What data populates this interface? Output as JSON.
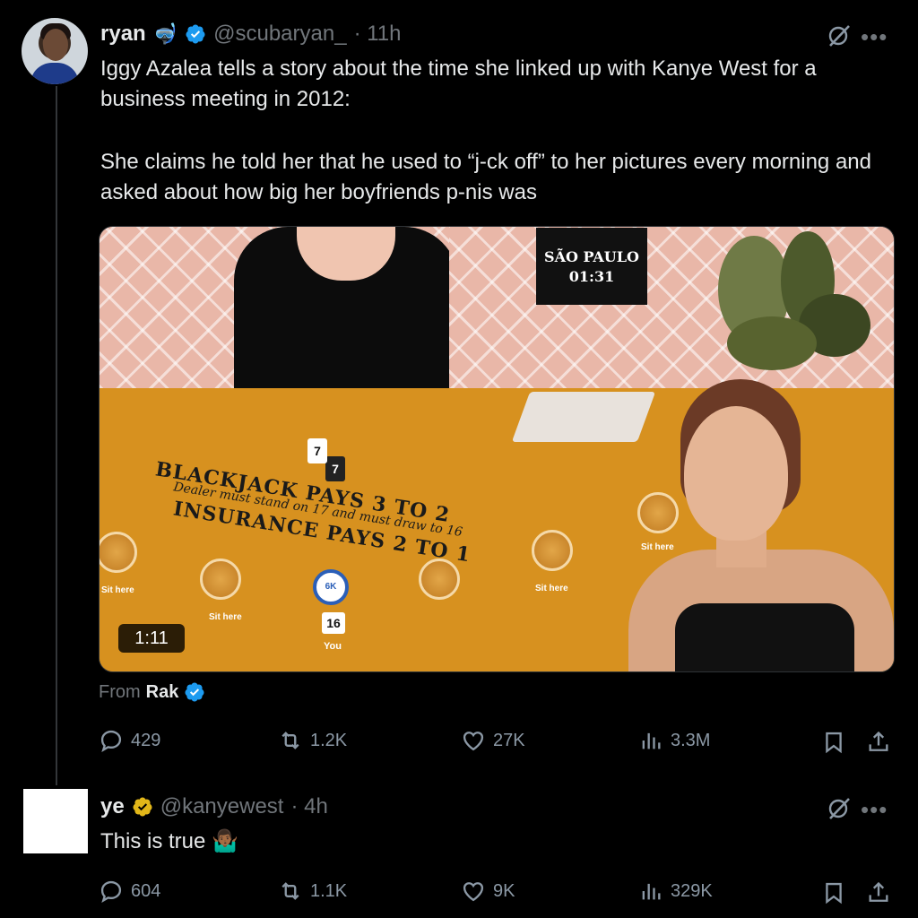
{
  "tweet1": {
    "name": "ryan",
    "name_emoji": "🤿",
    "handle": "@scubaryan_",
    "time": "· 11h",
    "text_p1": "Iggy Azalea tells a story about the time she linked up with Kanye West for a business meeting in 2012:",
    "text_p2": "She claims he told her that he used to “j-ck off” to her pictures every morning and asked about how big her boyfriends p-nis was",
    "video": {
      "duration": "1:11",
      "location": "SÃO PAULO",
      "location_time": "01:31",
      "table_text_main": "BLACKJACK PAYS 3 TO 2",
      "table_text_rule": "Dealer must stand on 17 and must draw to 16",
      "table_text_insurance": "INSURANCE PAYS 2 TO 1",
      "seat_label": "Sit here",
      "card_value": "7",
      "chip_label": "6K",
      "hand_total": "16",
      "you_label": "You"
    },
    "from_prefix": "From",
    "from_source": "Rak",
    "stats": {
      "replies": "429",
      "reposts": "1.2K",
      "likes": "27K",
      "views": "3.3M"
    }
  },
  "tweet2": {
    "name": "ye",
    "handle": "@kanyewest",
    "time": "· 4h",
    "text": "This is true 🤷🏾‍♂️",
    "stats": {
      "replies": "604",
      "reposts": "1.1K",
      "likes": "9K",
      "views": "329K"
    }
  },
  "colors": {
    "background": "#000000",
    "primary_text": "#e7e9ea",
    "secondary_text": "#71767b",
    "verified_blue": "#1d9bf0",
    "verified_gold": "#e2b719"
  },
  "icons": [
    "verified-badge-icon",
    "gold-verified-badge-icon",
    "grok-icon",
    "more-icon",
    "reply-icon",
    "repost-icon",
    "like-icon",
    "views-icon",
    "bookmark-icon",
    "share-icon"
  ]
}
